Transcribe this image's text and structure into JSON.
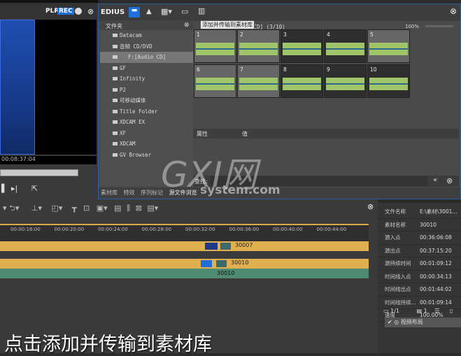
{
  "preview": {
    "plr": "PLR",
    "rec": "REC",
    "timecode": "00:08:37:04"
  },
  "library": {
    "app": "EDIUS",
    "tooltip": "添加并传输到素材库",
    "path": "[Audio CD] (3/10)",
    "zoom": "100%",
    "folder_header": "文件夹",
    "folders": [
      {
        "label": "Datacam"
      },
      {
        "label": "音频 CD/DVD",
        "expanded": true
      },
      {
        "label": "F:[Audio CD]",
        "selected": true
      },
      {
        "label": "GF"
      },
      {
        "label": "Infinity"
      },
      {
        "label": "P2"
      },
      {
        "label": "可移动媒体"
      },
      {
        "label": "Title Folder"
      },
      {
        "label": "XDCAM EX"
      },
      {
        "label": "XF"
      },
      {
        "label": "XDCAM"
      },
      {
        "label": "GV Browser"
      }
    ],
    "clips": [
      "1",
      "2",
      "3",
      "4",
      "5",
      "6",
      "7",
      "8",
      "9",
      "10"
    ],
    "props_header": {
      "property": "属性",
      "value": "值"
    },
    "search_label": "查找:",
    "tabs": [
      "素材库",
      "特效",
      "序列标记",
      "源文件浏览"
    ]
  },
  "timeline": {
    "ticks": [
      "00:00:16:00",
      "00:00:20:00",
      "00:00:24:00",
      "00:00:28:00",
      "00:00:32:00",
      "00:00:36:00",
      "00:00:40:00",
      "00:00:44:00"
    ],
    "clip1": "30007",
    "clip2": "30010",
    "clip3": "30010"
  },
  "info": {
    "rows": [
      {
        "k": "文件名称",
        "v": "E:\\素材\\3001..."
      },
      {
        "k": "素材名称",
        "v": "30010"
      },
      {
        "k": "源入点",
        "v": "00:36:06:08"
      },
      {
        "k": "源出点",
        "v": "00:37:15:20"
      },
      {
        "k": "源持续时间",
        "v": "00:01:09:12"
      },
      {
        "k": "时间线入点",
        "v": "00:00:34:13"
      },
      {
        "k": "时间线出点",
        "v": "00:01:44:02"
      },
      {
        "k": "时间线持续...",
        "v": "00:01:09:14"
      },
      {
        "k": "速度",
        "v": "100.00%"
      }
    ],
    "page": "1/1",
    "count": "1",
    "effect": "视频布局"
  },
  "subtitle": "点击添加并传输到素材库",
  "watermark": {
    "logo": "GXI网",
    "site": "system.com"
  },
  "colors": {
    "accent": "#1e6fd9",
    "clip_yellow": "#e0b050",
    "clip_green": "#4f8a72"
  }
}
